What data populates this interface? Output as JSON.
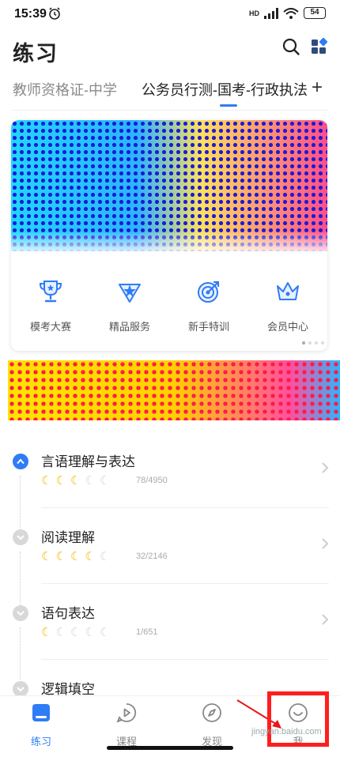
{
  "status_bar": {
    "time": "15:39",
    "network": "HD",
    "battery": "54"
  },
  "header": {
    "title": "练习"
  },
  "tabs": [
    {
      "label": "教师资格证-中学",
      "active": false
    },
    {
      "label": "公务员行测-国考-行政执法",
      "active": true
    }
  ],
  "tab_add_symbol": "+",
  "services": [
    {
      "label": "模考大赛",
      "icon": "trophy-icon"
    },
    {
      "label": "精品服务",
      "icon": "diamond-star-icon"
    },
    {
      "label": "新手特训",
      "icon": "target-icon"
    },
    {
      "label": "会员中心",
      "icon": "crown-icon"
    }
  ],
  "outline": [
    {
      "name": "言语理解与表达",
      "filled": 3,
      "total_moons": 5,
      "count": "78/4950",
      "expanded": true
    },
    {
      "name": "阅读理解",
      "filled": 4,
      "total_moons": 5,
      "count": "32/2146",
      "expanded": false
    },
    {
      "name": "语句表达",
      "filled": 1,
      "total_moons": 5,
      "count": "1/651",
      "expanded": false
    },
    {
      "name": "逻辑填空",
      "expanded": false
    }
  ],
  "bottom_nav": [
    {
      "label": "练习",
      "icon": "practice-icon",
      "active": true
    },
    {
      "label": "课程",
      "icon": "play-course-icon",
      "active": false
    },
    {
      "label": "发现",
      "icon": "compass-icon",
      "active": false
    },
    {
      "label": "我",
      "icon": "smile-icon",
      "active": false
    }
  ],
  "watermark": "jingyan.baidu.com",
  "colors": {
    "accent": "#2f7cf6",
    "moon_on": "#f7b500",
    "highlight": "#ff1e1e"
  }
}
